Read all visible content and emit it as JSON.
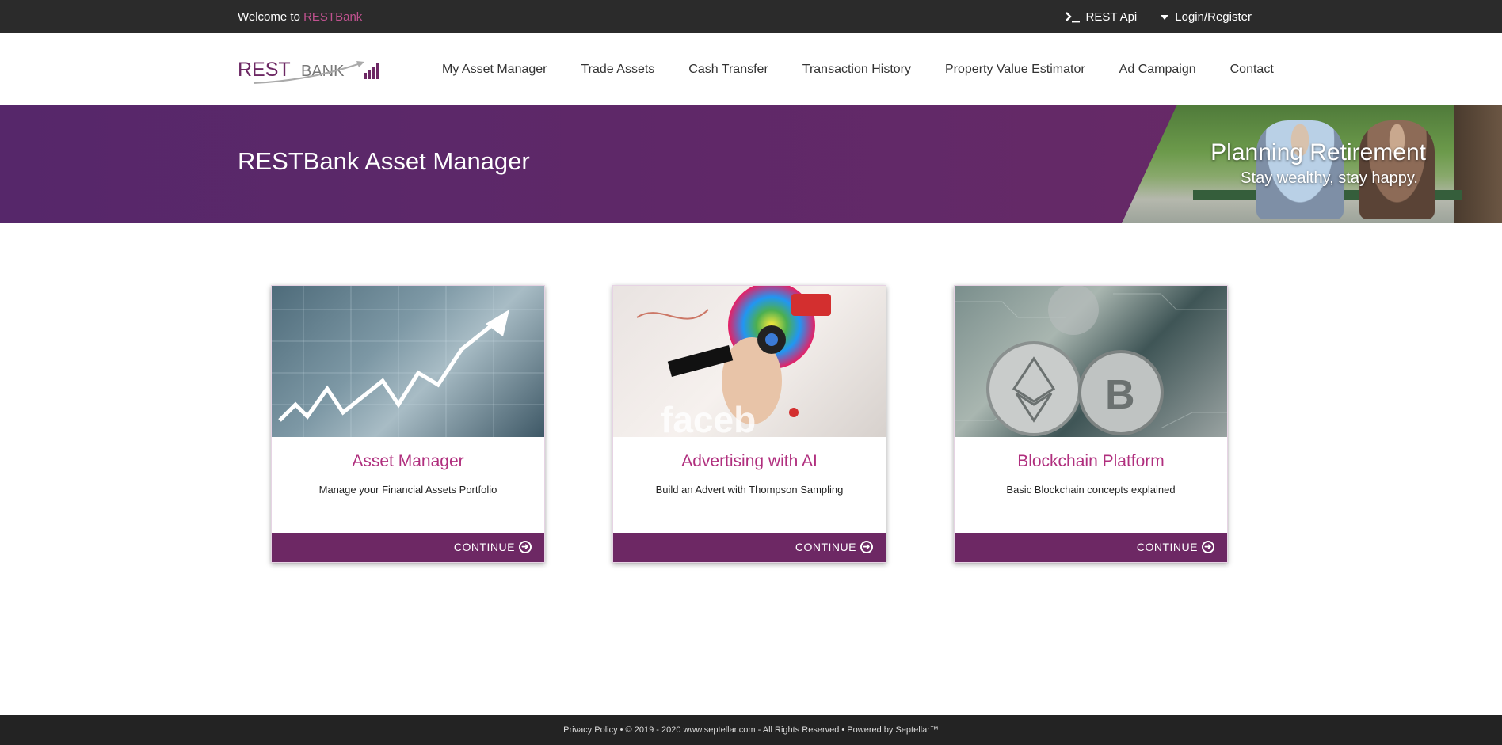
{
  "topbar": {
    "welcome_prefix": "Welcome to ",
    "welcome_brand": "RESTBank",
    "rest_api": "REST Api",
    "login": "Login/Register"
  },
  "logo": {
    "rest": "REST",
    "bank": "BANK"
  },
  "nav": {
    "items": [
      "My Asset Manager",
      "Trade Assets",
      "Cash Transfer",
      "Transaction History",
      "Property Value Estimator",
      "Ad Campaign",
      "Contact"
    ]
  },
  "banner": {
    "title": "RESTBank Asset Manager",
    "promo_title": "Planning Retirement",
    "promo_subtitle": "Stay wealthy, stay happy."
  },
  "cards": [
    {
      "title": "Asset Manager",
      "description": "Manage your Financial Assets Portfolio",
      "action": "CONTINUE"
    },
    {
      "title": "Advertising with AI",
      "description": "Build an Advert with Thompson Sampling",
      "action": "CONTINUE"
    },
    {
      "title": "Blockchain Platform",
      "description": "Basic Blockchain concepts explained",
      "action": "CONTINUE"
    }
  ],
  "footer": {
    "privacy": "Privacy Policy",
    "rest": " • © 2019 - 2020 www.septellar.com - All Rights Reserved • Powered by Septellar™"
  },
  "colors": {
    "accent": "#b02f7e",
    "banner": "#5c296a",
    "card_footer": "#6d2864",
    "topbar": "#2b2b2b"
  }
}
